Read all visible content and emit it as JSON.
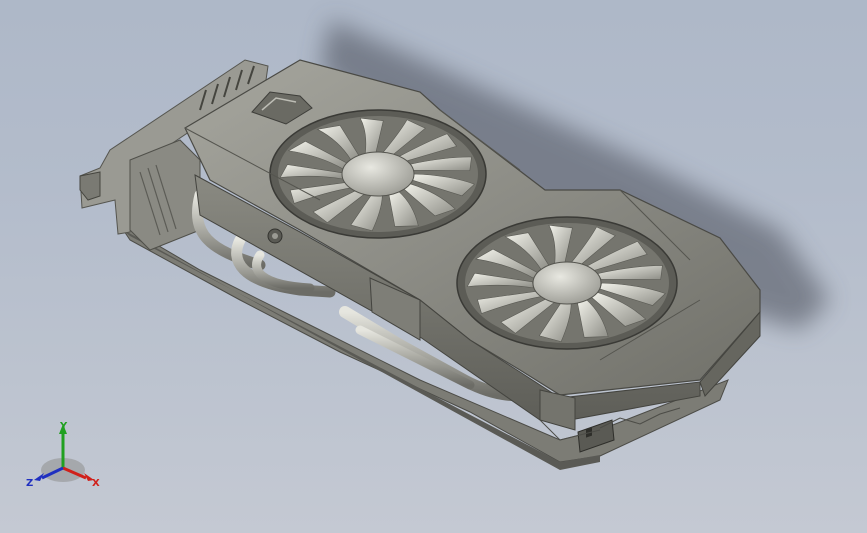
{
  "viewport": {
    "background_top": "#aeb8c8",
    "background_bottom": "#c4c9d3"
  },
  "model": {
    "part": "graphics-card",
    "body_color": "#8f8f88",
    "shade_color": "#6e6e68",
    "highlight_color": "#cfcfc6",
    "fan_count": 2,
    "logo_text": ""
  },
  "triad": {
    "x_label": "X",
    "y_label": "Y",
    "z_label": "Z",
    "x_color": "#d0201a",
    "y_color": "#20a020",
    "z_color": "#2030c0"
  }
}
